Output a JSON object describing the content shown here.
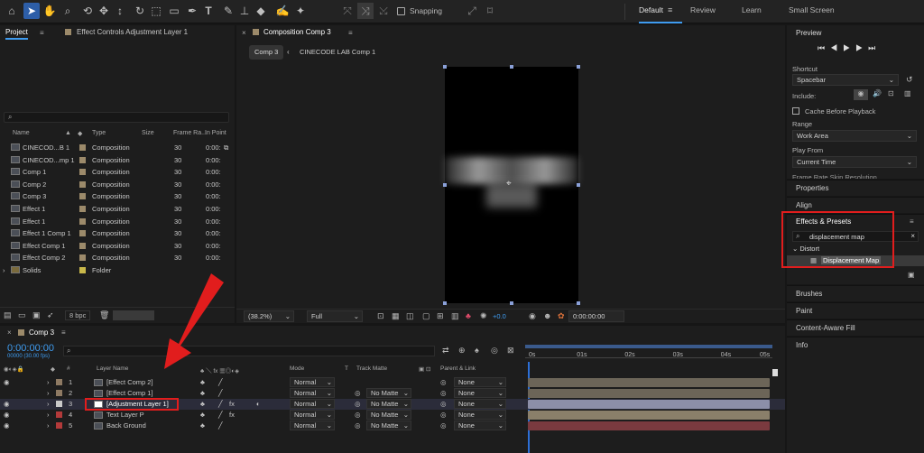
{
  "toolbar": {
    "snapping_label": "Snapping",
    "workspaces": [
      "Default",
      "Review",
      "Learn",
      "Small Screen"
    ],
    "active_workspace": "Default"
  },
  "project": {
    "tab_label": "Project",
    "effect_controls_tab": "Effect Controls Adjustment Layer 1",
    "columns": [
      "Name",
      "Type",
      "Size",
      "Frame Ra...",
      "In Point"
    ],
    "items": [
      {
        "name": "CINECOD...B 1",
        "type": "Composition",
        "fps": "30",
        "in": "0:00:"
      },
      {
        "name": "CINECOD...mp 1",
        "type": "Composition",
        "fps": "30",
        "in": "0:00:"
      },
      {
        "name": "Comp 1",
        "type": "Composition",
        "fps": "30",
        "in": "0:00:"
      },
      {
        "name": "Comp 2",
        "type": "Composition",
        "fps": "30",
        "in": "0:00:"
      },
      {
        "name": "Comp 3",
        "type": "Composition",
        "fps": "30",
        "in": "0:00:"
      },
      {
        "name": "Effect 1",
        "type": "Composition",
        "fps": "30",
        "in": "0:00:"
      },
      {
        "name": "Effect 1",
        "type": "Composition",
        "fps": "30",
        "in": "0:00:"
      },
      {
        "name": "Effect 1 Comp 1",
        "type": "Composition",
        "fps": "30",
        "in": "0:00:"
      },
      {
        "name": "Effect Comp 1",
        "type": "Composition",
        "fps": "30",
        "in": "0:00:"
      },
      {
        "name": "Effect Comp 2",
        "type": "Composition",
        "fps": "30",
        "in": "0:00:"
      },
      {
        "name": "Solids",
        "type": "Folder",
        "fps": "",
        "in": ""
      }
    ],
    "bpc": "8 bpc"
  },
  "composition": {
    "tab_label": "Composition Comp 3",
    "crumb_active": "Comp 3",
    "crumb_next": "CINECODE LAB Comp 1",
    "zoom": "(38.2%)",
    "quality": "Full",
    "exposure": "+0.0",
    "timecode": "0:00:00:00"
  },
  "preview": {
    "title": "Preview",
    "shortcut_label": "Shortcut",
    "shortcut_value": "Spacebar",
    "include_label": "Include:",
    "cache_label": "Cache Before Playback",
    "range_label": "Range",
    "range_value": "Work Area",
    "play_from_label": "Play From",
    "play_from_value": "Current Time",
    "cut_label": "Frame Rate    Skip    Resolution"
  },
  "right_panels": {
    "properties": "Properties",
    "align": "Align",
    "effects_title": "Effects & Presets",
    "search_value": "displacement map",
    "category": "Distort",
    "effect_item": "Displacement Map",
    "brushes": "Brushes",
    "paint": "Paint",
    "content_aware": "Content-Aware Fill",
    "info": "Info"
  },
  "timeline": {
    "tab_label": "Comp 3",
    "current_time": "0:00:00:00",
    "fps_label": "00000 (30.00 fps)",
    "headers": {
      "layer_name": "Layer Name",
      "mode": "Mode",
      "t": "T",
      "track_matte": "Track Matte",
      "parent": "Parent & Link",
      "num": "#"
    },
    "ruler": [
      "0s",
      "01s",
      "02s",
      "03s",
      "04s",
      "05s"
    ],
    "layers": [
      {
        "num": "1",
        "name": "[Effect Comp 2]",
        "mode": "Normal",
        "matte": "",
        "parent": "None",
        "color": "#8e7a63",
        "bar": "#6c6558"
      },
      {
        "num": "2",
        "name": "[Effect Comp 1]",
        "mode": "Normal",
        "matte": "No Matte",
        "parent": "None",
        "color": "#8e7a63",
        "bar": "#6c6558"
      },
      {
        "num": "3",
        "name": "[Adjustment Layer 1]",
        "mode": "Normal",
        "matte": "No Matte",
        "parent": "None",
        "color": "#c9c9c9",
        "bar": "#8c8fa8"
      },
      {
        "num": "4",
        "name": "Text Layer P",
        "mode": "Normal",
        "matte": "No Matte",
        "parent": "None",
        "color": "#b33a3a",
        "bar": "#8a7f6a"
      },
      {
        "num": "5",
        "name": "Back Ground",
        "mode": "Normal",
        "matte": "No Matte",
        "parent": "None",
        "color": "#b33a3a",
        "bar": "#7a3a3f"
      }
    ]
  },
  "colors": {
    "accent": "#2d8ceb",
    "highlight": "#e11d1d",
    "timecode": "#3f9cf0"
  }
}
